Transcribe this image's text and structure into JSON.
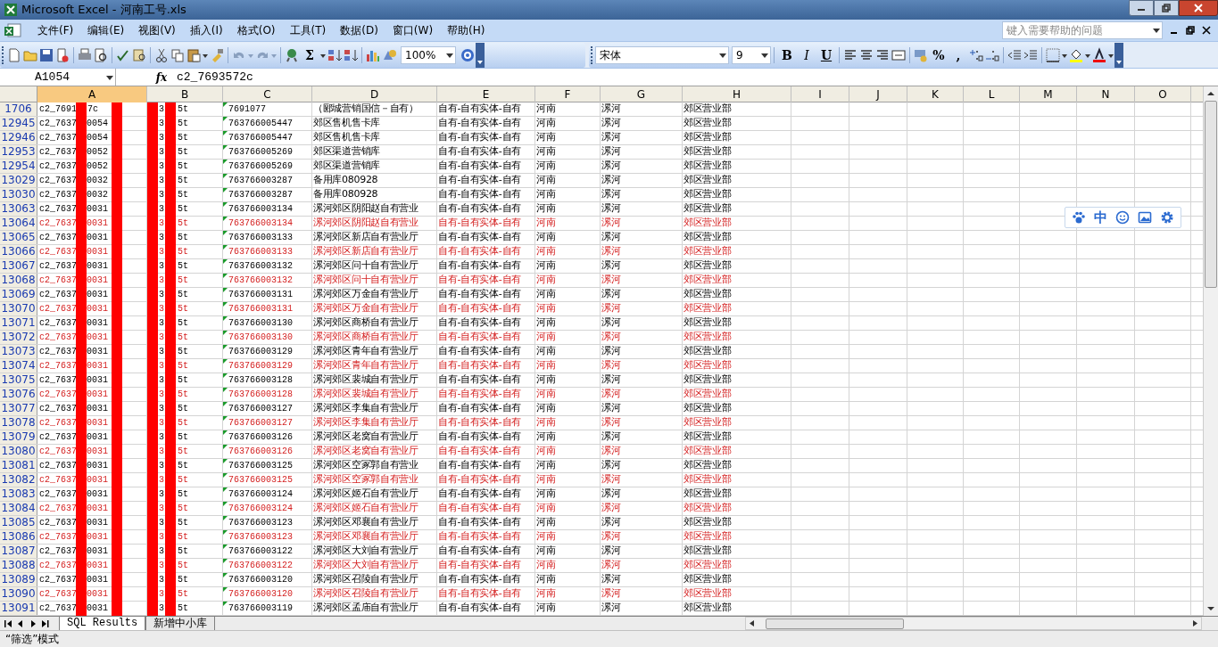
{
  "window": {
    "title": "Microsoft Excel - 河南工号.xls"
  },
  "menu": [
    "文件(F)",
    "编辑(E)",
    "视图(V)",
    "插入(I)",
    "格式(O)",
    "工具(T)",
    "数据(D)",
    "窗口(W)",
    "帮助(H)"
  ],
  "help_search": {
    "placeholder": "键入需要帮助的问题"
  },
  "toolbar": {
    "sum": "Σ",
    "zoom": "100%",
    "font": "宋体",
    "font_size": "9",
    "bold": "B",
    "italic": "I",
    "underline": "U",
    "percent": "%",
    "comma": ","
  },
  "formula_bar": {
    "name_box": "A1054",
    "fx": "fx",
    "formula": "c2_7693572c"
  },
  "columns": [
    {
      "label": "A",
      "selected": true
    },
    {
      "label": "B",
      "selected": false
    },
    {
      "label": "C",
      "selected": false
    },
    {
      "label": "D",
      "selected": false
    },
    {
      "label": "E",
      "selected": false
    },
    {
      "label": "F",
      "selected": false
    },
    {
      "label": "G",
      "selected": false
    },
    {
      "label": "H",
      "selected": false
    },
    {
      "label": "I",
      "selected": false
    },
    {
      "label": "J",
      "selected": false
    },
    {
      "label": "K",
      "selected": false
    },
    {
      "label": "L",
      "selected": false
    },
    {
      "label": "M",
      "selected": false
    },
    {
      "label": "N",
      "selected": false
    },
    {
      "label": "O",
      "selected": false
    }
  ],
  "rows": [
    {
      "row": "1706",
      "a": [
        "c2_7691",
        "7c"
      ],
      "b": [
        "3",
        "5t"
      ],
      "c": "7691077",
      "d": "（郾城营销国信－自有）",
      "e": "自有-自有实体-自有",
      "f": "河南",
      "g": "漯河",
      "h": "郊区营业部",
      "highlighted": false
    },
    {
      "row": "12945",
      "a": [
        "c2_7637",
        "0054"
      ],
      "b": [
        "3",
        "5t"
      ],
      "c": "763766005447",
      "d": "郊区售机售卡库",
      "e": "自有-自有实体-自有",
      "f": "河南",
      "g": "漯河",
      "h": "郊区营业部",
      "highlighted": false
    },
    {
      "row": "12946",
      "a": [
        "c2_7637",
        "0054"
      ],
      "b": [
        "3",
        "5t"
      ],
      "c": "763766005447",
      "d": "郊区售机售卡库",
      "e": "自有-自有实体-自有",
      "f": "河南",
      "g": "漯河",
      "h": "郊区营业部",
      "highlighted": false
    },
    {
      "row": "12953",
      "a": [
        "c2_7637",
        "0052"
      ],
      "b": [
        "3",
        "5t"
      ],
      "c": "763766005269",
      "d": "郊区渠道营销库",
      "e": "自有-自有实体-自有",
      "f": "河南",
      "g": "漯河",
      "h": "郊区营业部",
      "highlighted": false
    },
    {
      "row": "12954",
      "a": [
        "c2_7637",
        "0052"
      ],
      "b": [
        "3",
        "5t"
      ],
      "c": "763766005269",
      "d": "郊区渠道营销库",
      "e": "自有-自有实体-自有",
      "f": "河南",
      "g": "漯河",
      "h": "郊区营业部",
      "highlighted": false
    },
    {
      "row": "13029",
      "a": [
        "c2_7637",
        "0032"
      ],
      "b": [
        "3",
        "5t"
      ],
      "c": "763766003287",
      "d": "备用库080928",
      "e": "自有-自有实体-自有",
      "f": "河南",
      "g": "漯河",
      "h": "郊区营业部",
      "highlighted": false
    },
    {
      "row": "13030",
      "a": [
        "c2_7637",
        "0032"
      ],
      "b": [
        "3",
        "5t"
      ],
      "c": "763766003287",
      "d": "备用库080928",
      "e": "自有-自有实体-自有",
      "f": "河南",
      "g": "漯河",
      "h": "郊区营业部",
      "highlighted": false
    },
    {
      "row": "13063",
      "a": [
        "c2_7637",
        "0031"
      ],
      "b": [
        "3",
        "5t"
      ],
      "c": "763766003134",
      "d": "漯河郊区阴阳赵自有营业",
      "e": "自有-自有实体-自有",
      "f": "河南",
      "g": "漯河",
      "h": "郊区营业部",
      "highlighted": false
    },
    {
      "row": "13064",
      "a": [
        "c2_7637",
        "0031"
      ],
      "b": [
        "3",
        "5t"
      ],
      "c": "763766003134",
      "d": "漯河郊区阴阳赵自有营业",
      "e": "自有-自有实体-自有",
      "f": "河南",
      "g": "漯河",
      "h": "郊区营业部",
      "highlighted": true
    },
    {
      "row": "13065",
      "a": [
        "c2_7637",
        "0031"
      ],
      "b": [
        "3",
        "5t"
      ],
      "c": "763766003133",
      "d": "漯河郊区新店自有营业厅",
      "e": "自有-自有实体-自有",
      "f": "河南",
      "g": "漯河",
      "h": "郊区营业部",
      "highlighted": false
    },
    {
      "row": "13066",
      "a": [
        "c2_7637",
        "0031"
      ],
      "b": [
        "3",
        "5t"
      ],
      "c": "763766003133",
      "d": "漯河郊区新店自有营业厅",
      "e": "自有-自有实体-自有",
      "f": "河南",
      "g": "漯河",
      "h": "郊区营业部",
      "highlighted": true
    },
    {
      "row": "13067",
      "a": [
        "c2_7637",
        "0031"
      ],
      "b": [
        "3",
        "5t"
      ],
      "c": "763766003132",
      "d": "漯河郊区问十自有营业厅",
      "e": "自有-自有实体-自有",
      "f": "河南",
      "g": "漯河",
      "h": "郊区营业部",
      "highlighted": false
    },
    {
      "row": "13068",
      "a": [
        "c2_7637",
        "0031"
      ],
      "b": [
        "3",
        "5t"
      ],
      "c": "763766003132",
      "d": "漯河郊区问十自有营业厅",
      "e": "自有-自有实体-自有",
      "f": "河南",
      "g": "漯河",
      "h": "郊区营业部",
      "highlighted": true
    },
    {
      "row": "13069",
      "a": [
        "c2_7637",
        "0031"
      ],
      "b": [
        "3",
        "5t"
      ],
      "c": "763766003131",
      "d": "漯河郊区万金自有营业厅",
      "e": "自有-自有实体-自有",
      "f": "河南",
      "g": "漯河",
      "h": "郊区营业部",
      "highlighted": false
    },
    {
      "row": "13070",
      "a": [
        "c2_7637",
        "0031"
      ],
      "b": [
        "3",
        "5t"
      ],
      "c": "763766003131",
      "d": "漯河郊区万金自有营业厅",
      "e": "自有-自有实体-自有",
      "f": "河南",
      "g": "漯河",
      "h": "郊区营业部",
      "highlighted": true
    },
    {
      "row": "13071",
      "a": [
        "c2_7637",
        "0031"
      ],
      "b": [
        "3",
        "5t"
      ],
      "c": "763766003130",
      "d": "漯河郊区商桥自有营业厅",
      "e": "自有-自有实体-自有",
      "f": "河南",
      "g": "漯河",
      "h": "郊区营业部",
      "highlighted": false
    },
    {
      "row": "13072",
      "a": [
        "c2_7637",
        "0031"
      ],
      "b": [
        "3",
        "5t"
      ],
      "c": "763766003130",
      "d": "漯河郊区商桥自有营业厅",
      "e": "自有-自有实体-自有",
      "f": "河南",
      "g": "漯河",
      "h": "郊区营业部",
      "highlighted": true
    },
    {
      "row": "13073",
      "a": [
        "c2_7637",
        "0031"
      ],
      "b": [
        "3",
        "5t"
      ],
      "c": "763766003129",
      "d": "漯河郊区青年自有营业厅",
      "e": "自有-自有实体-自有",
      "f": "河南",
      "g": "漯河",
      "h": "郊区营业部",
      "highlighted": false
    },
    {
      "row": "13074",
      "a": [
        "c2_7637",
        "0031"
      ],
      "b": [
        "3",
        "5t"
      ],
      "c": "763766003129",
      "d": "漯河郊区青年自有营业厅",
      "e": "自有-自有实体-自有",
      "f": "河南",
      "g": "漯河",
      "h": "郊区营业部",
      "highlighted": true
    },
    {
      "row": "13075",
      "a": [
        "c2_7637",
        "0031"
      ],
      "b": [
        "3",
        "5t"
      ],
      "c": "763766003128",
      "d": "漯河郊区裴城自有营业厅",
      "e": "自有-自有实体-自有",
      "f": "河南",
      "g": "漯河",
      "h": "郊区营业部",
      "highlighted": false
    },
    {
      "row": "13076",
      "a": [
        "c2_7637",
        "0031"
      ],
      "b": [
        "3",
        "5t"
      ],
      "c": "763766003128",
      "d": "漯河郊区裴城自有营业厅",
      "e": "自有-自有实体-自有",
      "f": "河南",
      "g": "漯河",
      "h": "郊区营业部",
      "highlighted": true
    },
    {
      "row": "13077",
      "a": [
        "c2_7637",
        "0031"
      ],
      "b": [
        "3",
        "5t"
      ],
      "c": "763766003127",
      "d": "漯河郊区李集自有营业厅",
      "e": "自有-自有实体-自有",
      "f": "河南",
      "g": "漯河",
      "h": "郊区营业部",
      "highlighted": false
    },
    {
      "row": "13078",
      "a": [
        "c2_7637",
        "0031"
      ],
      "b": [
        "3",
        "5t"
      ],
      "c": "763766003127",
      "d": "漯河郊区李集自有营业厅",
      "e": "自有-自有实体-自有",
      "f": "河南",
      "g": "漯河",
      "h": "郊区营业部",
      "highlighted": true
    },
    {
      "row": "13079",
      "a": [
        "c2_7637",
        "0031"
      ],
      "b": [
        "3",
        "5t"
      ],
      "c": "763766003126",
      "d": "漯河郊区老窝自有营业厅",
      "e": "自有-自有实体-自有",
      "f": "河南",
      "g": "漯河",
      "h": "郊区营业部",
      "highlighted": false
    },
    {
      "row": "13080",
      "a": [
        "c2_7637",
        "0031"
      ],
      "b": [
        "3",
        "5t"
      ],
      "c": "763766003126",
      "d": "漯河郊区老窝自有营业厅",
      "e": "自有-自有实体-自有",
      "f": "河南",
      "g": "漯河",
      "h": "郊区营业部",
      "highlighted": true
    },
    {
      "row": "13081",
      "a": [
        "c2_7637",
        "0031"
      ],
      "b": [
        "3",
        "5t"
      ],
      "c": "763766003125",
      "d": "漯河郊区空冢郭自有营业",
      "e": "自有-自有实体-自有",
      "f": "河南",
      "g": "漯河",
      "h": "郊区营业部",
      "highlighted": false
    },
    {
      "row": "13082",
      "a": [
        "c2_7637",
        "0031"
      ],
      "b": [
        "3",
        "5t"
      ],
      "c": "763766003125",
      "d": "漯河郊区空冢郭自有营业",
      "e": "自有-自有实体-自有",
      "f": "河南",
      "g": "漯河",
      "h": "郊区营业部",
      "highlighted": true
    },
    {
      "row": "13083",
      "a": [
        "c2_7637",
        "0031"
      ],
      "b": [
        "3",
        "5t"
      ],
      "c": "763766003124",
      "d": "漯河郊区姬石自有营业厅",
      "e": "自有-自有实体-自有",
      "f": "河南",
      "g": "漯河",
      "h": "郊区营业部",
      "highlighted": false
    },
    {
      "row": "13084",
      "a": [
        "c2_7637",
        "0031"
      ],
      "b": [
        "3",
        "5t"
      ],
      "c": "763766003124",
      "d": "漯河郊区姬石自有营业厅",
      "e": "自有-自有实体-自有",
      "f": "河南",
      "g": "漯河",
      "h": "郊区营业部",
      "highlighted": true
    },
    {
      "row": "13085",
      "a": [
        "c2_7637",
        "0031"
      ],
      "b": [
        "3",
        "5t"
      ],
      "c": "763766003123",
      "d": "漯河郊区邓襄自有营业厅",
      "e": "自有-自有实体-自有",
      "f": "河南",
      "g": "漯河",
      "h": "郊区营业部",
      "highlighted": false
    },
    {
      "row": "13086",
      "a": [
        "c2_7637",
        "0031"
      ],
      "b": [
        "3",
        "5t"
      ],
      "c": "763766003123",
      "d": "漯河郊区邓襄自有营业厅",
      "e": "自有-自有实体-自有",
      "f": "河南",
      "g": "漯河",
      "h": "郊区营业部",
      "highlighted": true
    },
    {
      "row": "13087",
      "a": [
        "c2_7637",
        "0031"
      ],
      "b": [
        "3",
        "5t"
      ],
      "c": "763766003122",
      "d": "漯河郊区大刘自有营业厅",
      "e": "自有-自有实体-自有",
      "f": "河南",
      "g": "漯河",
      "h": "郊区营业部",
      "highlighted": false
    },
    {
      "row": "13088",
      "a": [
        "c2_7637",
        "0031"
      ],
      "b": [
        "3",
        "5t"
      ],
      "c": "763766003122",
      "d": "漯河郊区大刘自有营业厅",
      "e": "自有-自有实体-自有",
      "f": "河南",
      "g": "漯河",
      "h": "郊区营业部",
      "highlighted": true
    },
    {
      "row": "13089",
      "a": [
        "c2_7637",
        "0031"
      ],
      "b": [
        "3",
        "5t"
      ],
      "c": "763766003120",
      "d": "漯河郊区召陵自有营业厅",
      "e": "自有-自有实体-自有",
      "f": "河南",
      "g": "漯河",
      "h": "郊区营业部",
      "highlighted": false
    },
    {
      "row": "13090",
      "a": [
        "c2_7637",
        "0031"
      ],
      "b": [
        "3",
        "5t"
      ],
      "c": "763766003120",
      "d": "漯河郊区召陵自有营业厅",
      "e": "自有-自有实体-自有",
      "f": "河南",
      "g": "漯河",
      "h": "郊区营业部",
      "highlighted": true
    },
    {
      "row": "13091",
      "a": [
        "c2_7637",
        "0031"
      ],
      "b": [
        "3",
        "5t"
      ],
      "c": "763766003119",
      "d": "漯河郊区孟庙自有营业厅",
      "e": "自有-自有实体-自有",
      "f": "河南",
      "g": "漯河",
      "h": "郊区营业部",
      "highlighted": false
    }
  ],
  "ime_toolbar": {
    "mode": "中"
  },
  "sheet_tabs": [
    {
      "label": "SQL Results",
      "selected": true
    },
    {
      "label": "新增中小库",
      "selected": false
    }
  ],
  "status_bar": {
    "text": "“筛选”模式"
  }
}
